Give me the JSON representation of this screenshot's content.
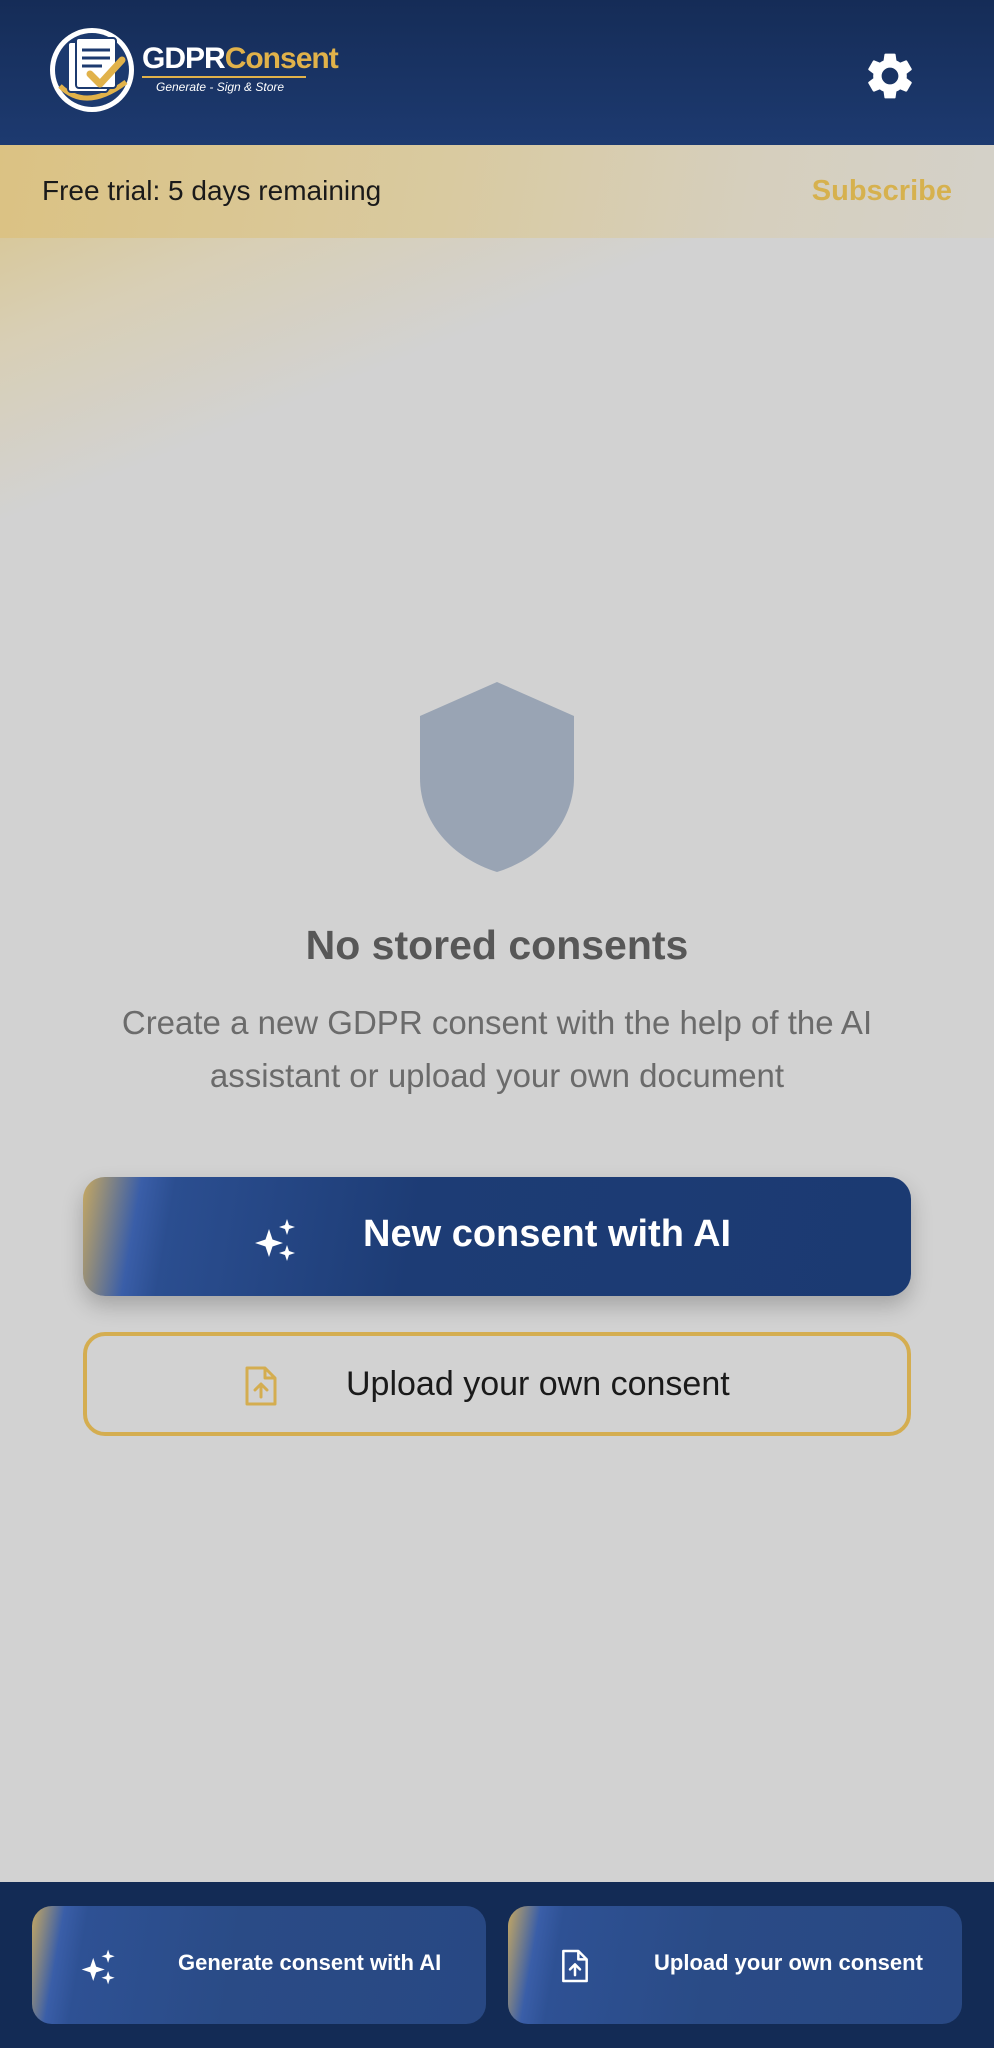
{
  "header": {
    "logo": {
      "title_part1": "GDPR",
      "title_part2": "Consent",
      "tagline": "Generate - Sign & Store",
      "icon": "document-check-icon"
    },
    "settings_icon": "gear-icon"
  },
  "trial_bar": {
    "text": "Free trial: 5 days remaining",
    "subscribe_label": "Subscribe"
  },
  "empty_state": {
    "icon": "shield-icon",
    "title": "No stored consents",
    "description": "Create a new GDPR consent with the help of the AI assistant or upload your own document"
  },
  "actions": {
    "ai_button": {
      "label": "New consent with AI",
      "icon": "sparkles-icon"
    },
    "upload_button": {
      "label": "Upload your own consent",
      "icon": "file-upload-icon"
    }
  },
  "bottom_bar": {
    "generate_label": "Generate consent with AI",
    "upload_label": "Upload your own consent"
  },
  "colors": {
    "header_navy": "#1d3a70",
    "accent_gold": "#d4ad50",
    "shield_grey": "#99a4b4",
    "background": "#d2d2d2"
  }
}
